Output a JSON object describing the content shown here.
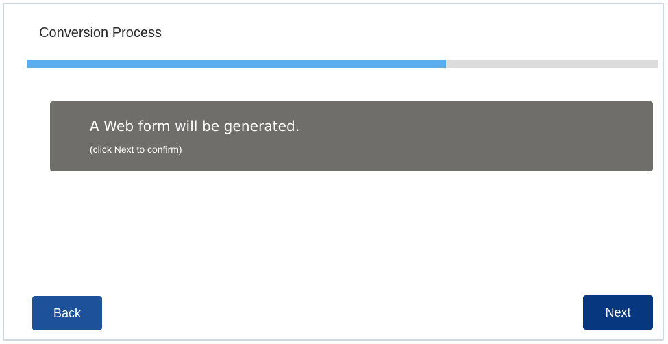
{
  "header": {
    "title": "Conversion Process"
  },
  "progress": {
    "percent": 66.5
  },
  "message": {
    "main": "A Web form will be generated.",
    "sub": "(click Next to confirm)"
  },
  "buttons": {
    "back_label": "Back",
    "next_label": "Next"
  },
  "colors": {
    "progress_fill": "#5aaef0",
    "progress_track": "#dcdcdc",
    "message_bg": "#706e6b",
    "back_button": "#1d519a",
    "next_button": "#07387f"
  }
}
